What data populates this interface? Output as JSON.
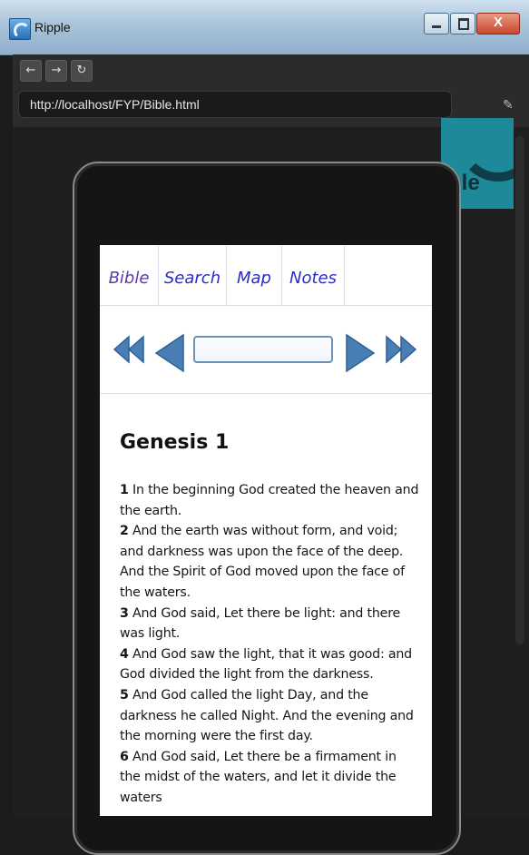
{
  "window": {
    "title": "Ripple"
  },
  "toolbar": {
    "back": "←",
    "forward": "→",
    "reload": "↻",
    "url": "http://localhost/FYP/Bible.html",
    "wrench": "🔧"
  },
  "tabs": [
    {
      "label": "Bible",
      "active": true
    },
    {
      "label": "Search",
      "active": false
    },
    {
      "label": "Map",
      "active": false
    },
    {
      "label": "Notes",
      "active": false
    }
  ],
  "chapter": {
    "title": "Genesis 1",
    "input_value": "",
    "verses": [
      {
        "n": "1",
        "text": "In the beginning God created the heaven and the earth."
      },
      {
        "n": "2",
        "text": "And the earth was without form, and void; and darkness was upon the face of the deep. And the Spirit of God moved upon the face of the waters."
      },
      {
        "n": "3",
        "text": "And God said, Let there be light: and there was light."
      },
      {
        "n": "4",
        "text": "And God saw the light, that it was good: and God divided the light from the darkness."
      },
      {
        "n": "5",
        "text": "And God called the light Day, and the darkness he called Night. And the evening and the morning were the first day."
      },
      {
        "n": "6",
        "text": "And God said, Let there be a firmament in the midst of the waters, and let it divide the waters"
      }
    ]
  },
  "colors": {
    "accent": "#4a7fb5",
    "tab_link": "#2b2bc8",
    "tab_active": "#5e3aa8"
  }
}
